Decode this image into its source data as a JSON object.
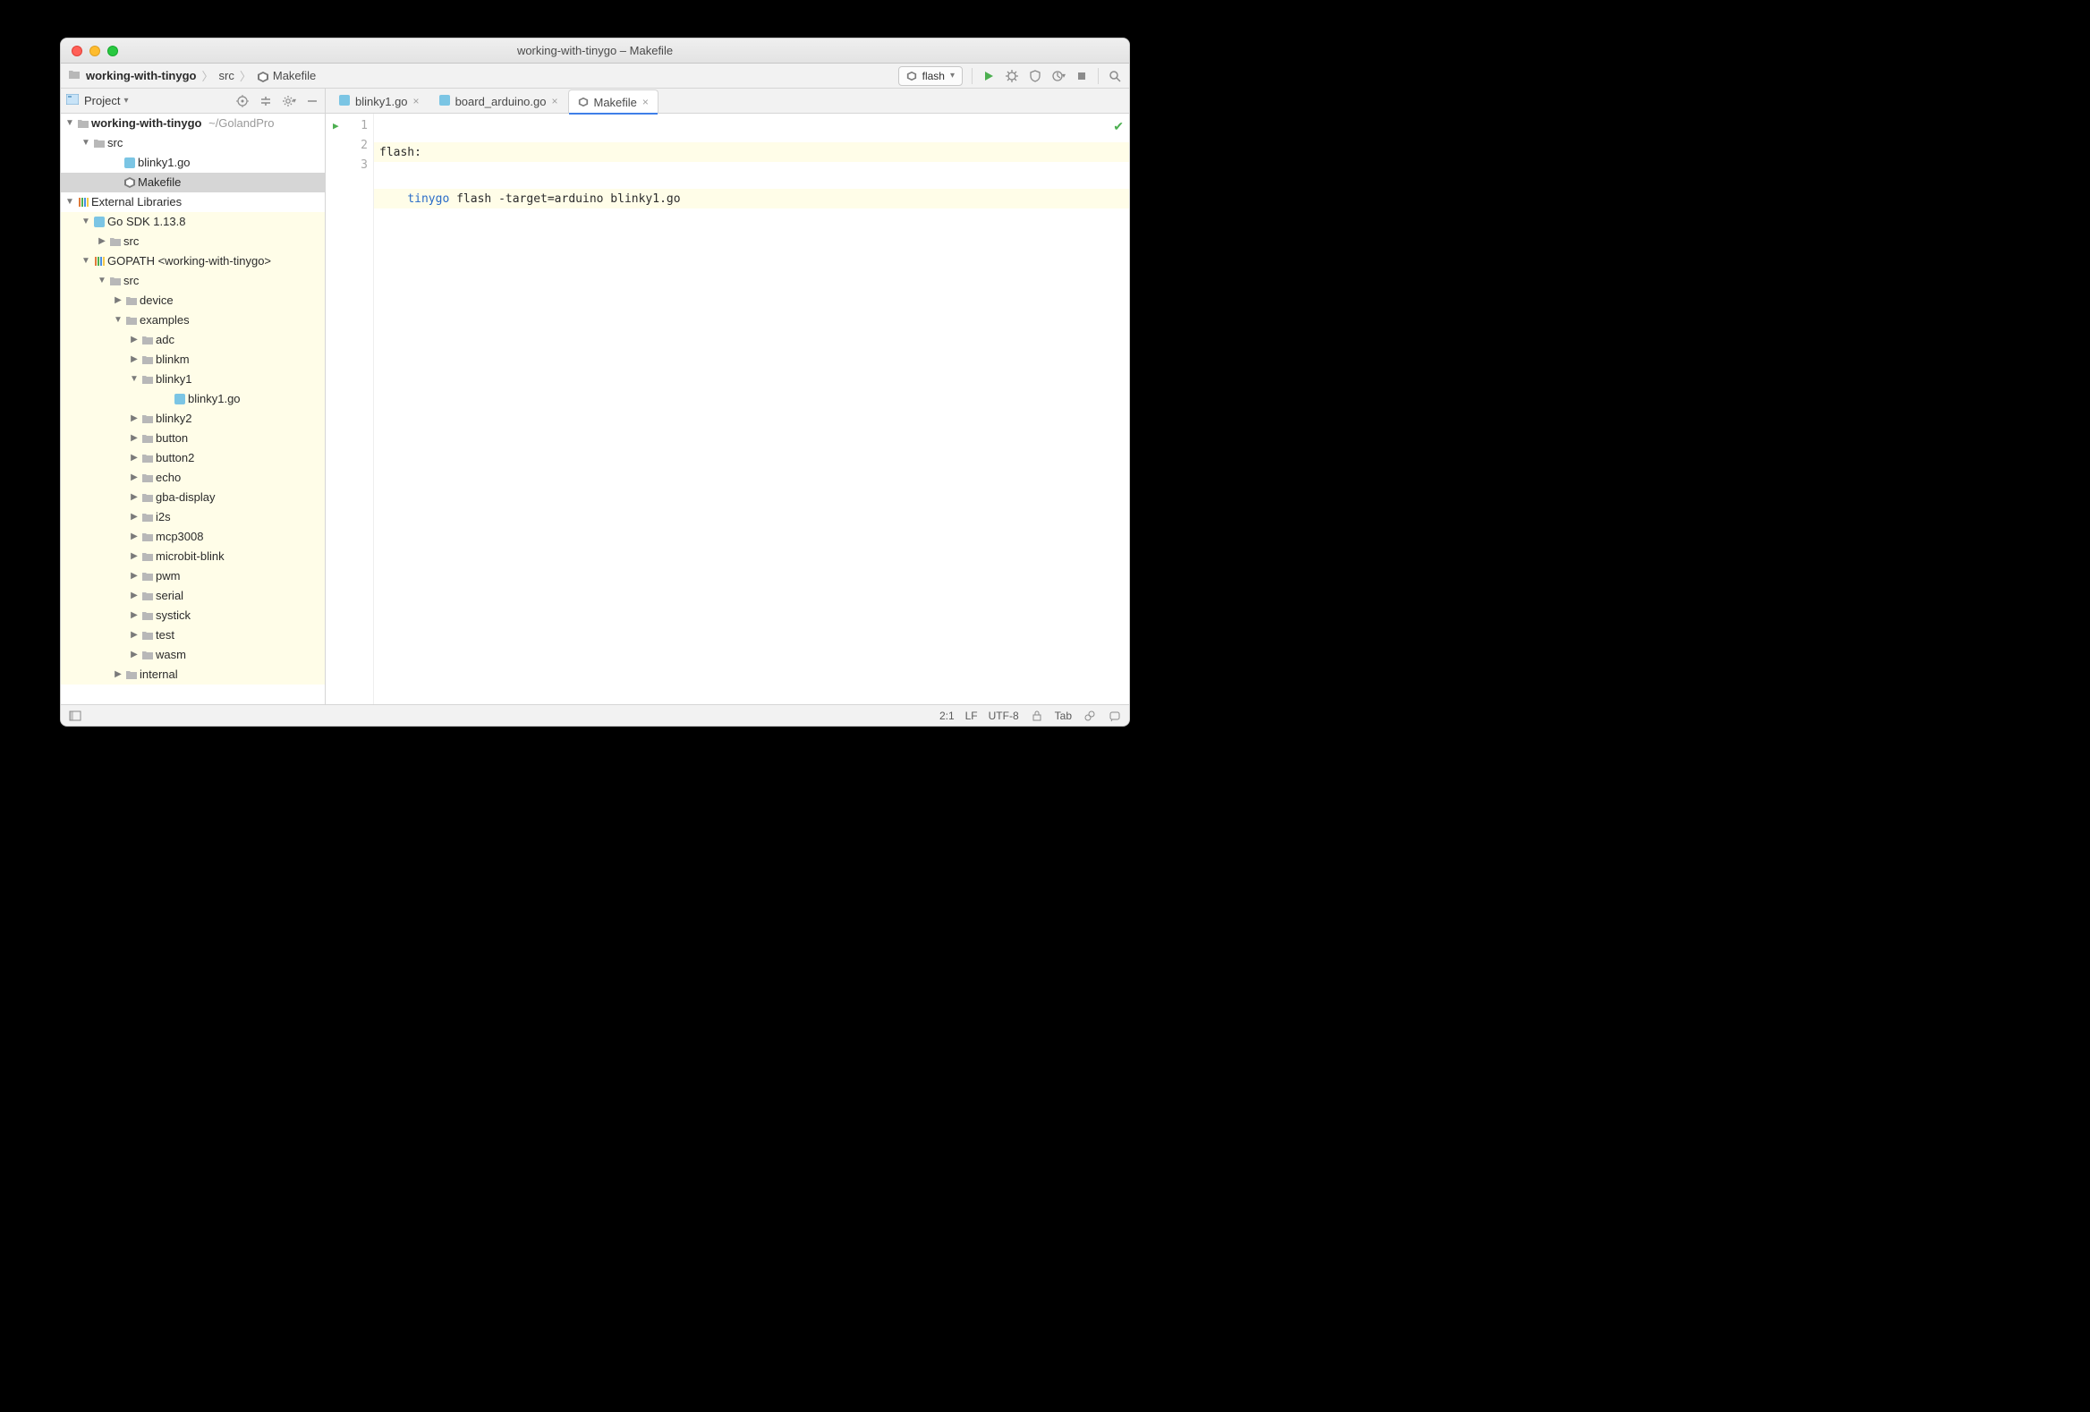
{
  "window": {
    "title": "working-with-tinygo – Makefile"
  },
  "breadcrumb": {
    "root": "working-with-tinygo",
    "mid": "src",
    "leaf": "Makefile"
  },
  "run_config": {
    "label": "flash"
  },
  "project_panel": {
    "label": "Project"
  },
  "tree": {
    "root": {
      "name": "working-with-tinygo",
      "path_hint": "~/GolandProjects/working-with-tinygo"
    },
    "src": {
      "name": "src"
    },
    "files": {
      "blinky1": "blinky1.go",
      "makefile": "Makefile"
    },
    "external_libraries": {
      "label": "External Libraries"
    },
    "go_sdk": {
      "label": "Go SDK 1.13.8"
    },
    "go_sdk_src": "src",
    "gopath": {
      "label": "GOPATH <working-with-tinygo>"
    },
    "gopath_src": "src",
    "device": "device",
    "examples": "examples",
    "examples_children": {
      "adc": "adc",
      "blinkm": "blinkm",
      "blinky1": "blinky1",
      "blinky1_file": "blinky1.go",
      "blinky2": "blinky2",
      "button": "button",
      "button2": "button2",
      "echo": "echo",
      "gba_display": "gba-display",
      "i2s": "i2s",
      "mcp3008": "mcp3008",
      "microbit_blink": "microbit-blink",
      "pwm": "pwm",
      "serial": "serial",
      "systick": "systick",
      "test": "test",
      "wasm": "wasm"
    },
    "internal": "internal"
  },
  "tabs": {
    "t1": "blinky1.go",
    "t2": "board_arduino.go",
    "t3": "Makefile"
  },
  "editor": {
    "lines": [
      "1",
      "2",
      "3"
    ],
    "code": {
      "l1": "flash:",
      "l2_kw": "tinygo",
      "l2_rest": " flash -target=arduino blinky1.go",
      "l3": ""
    }
  },
  "status": {
    "position": "2:1",
    "line_ending": "LF",
    "encoding": "UTF-8",
    "indent": "Tab"
  }
}
